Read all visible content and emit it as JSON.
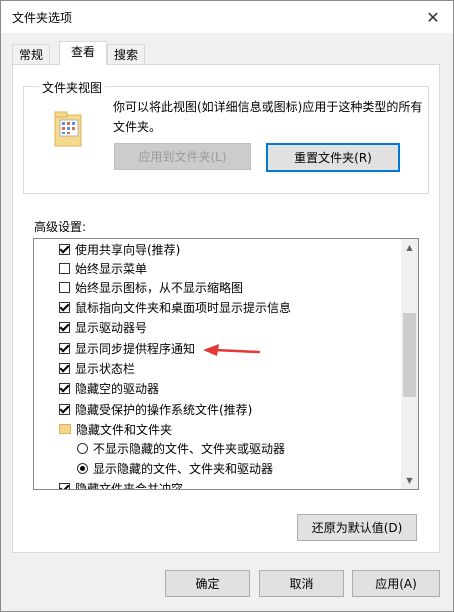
{
  "dialog": {
    "title": "文件夹选项",
    "close_glyph": "✕"
  },
  "tabs": [
    {
      "label": "常规",
      "active": false
    },
    {
      "label": "查看",
      "active": true
    },
    {
      "label": "搜索",
      "active": false
    }
  ],
  "folder_view": {
    "group_title": "文件夹视图",
    "description": "你可以将此视图(如详细信息或图标)应用于这种类型的所有文件夹。",
    "apply_button": "应用到文件夹(L)",
    "reset_button": "重置文件夹(R)"
  },
  "advanced": {
    "label": "高级设置:",
    "items": [
      {
        "type": "checkbox",
        "checked": true,
        "label": "使用共享向导(推荐)"
      },
      {
        "type": "checkbox",
        "checked": false,
        "label": "始终显示菜单"
      },
      {
        "type": "checkbox",
        "checked": false,
        "label": "始终显示图标，从不显示缩略图"
      },
      {
        "type": "checkbox",
        "checked": true,
        "label": "鼠标指向文件夹和桌面项时显示提示信息"
      },
      {
        "type": "checkbox",
        "checked": true,
        "label": "显示驱动器号"
      },
      {
        "type": "checkbox",
        "checked": true,
        "label": "显示同步提供程序通知"
      },
      {
        "type": "checkbox",
        "checked": true,
        "label": "显示状态栏"
      },
      {
        "type": "checkbox",
        "checked": true,
        "label": "隐藏空的驱动器"
      },
      {
        "type": "checkbox",
        "checked": true,
        "label": "隐藏受保护的操作系统文件(推荐)"
      },
      {
        "type": "folder",
        "checked": false,
        "label": "隐藏文件和文件夹"
      },
      {
        "type": "radio",
        "checked": false,
        "label": "不显示隐藏的文件、文件夹或驱动器"
      },
      {
        "type": "radio",
        "checked": true,
        "label": "显示隐藏的文件、文件夹和驱动器"
      },
      {
        "type": "checkbox",
        "checked": true,
        "label": "隐藏文件夹合并冲突"
      }
    ],
    "restore_button": "还原为默认值(D)"
  },
  "footer": {
    "ok": "确定",
    "cancel": "取消",
    "apply": "应用(A)"
  },
  "colors": {
    "accent": "#0078d7",
    "annotation_arrow": "#e53935"
  }
}
